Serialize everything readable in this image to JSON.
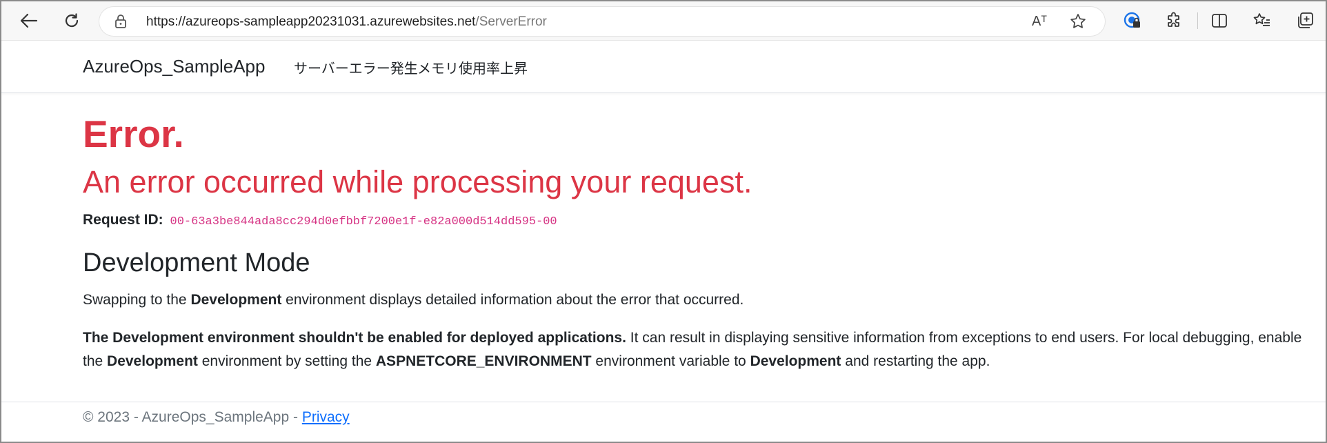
{
  "browser": {
    "url_host": "https://azureops-sampleapp20231031.azurewebsites.net",
    "url_path": "/ServerError",
    "read_aloud_label": "Aᵀ",
    "icons": [
      "back-icon",
      "refresh-icon",
      "lock-icon",
      "read-aloud-icon",
      "favorite-star-icon",
      "account-shield-icon",
      "extensions-icon",
      "split-screen-icon",
      "favorites-icon",
      "collections-icon"
    ]
  },
  "navbar": {
    "brand": "AzureOps_SampleApp",
    "links": [
      "サーバーエラー発生",
      "メモリ使用率上昇"
    ]
  },
  "error": {
    "title": "Error.",
    "subtitle": "An error occurred while processing your request.",
    "request_label": "Request ID:",
    "request_id": "00-63a3be844ada8cc294d0efbbf7200e1f-e82a000d514dd595-00"
  },
  "dev_mode": {
    "heading": "Development Mode",
    "p1_a": "Swapping to the ",
    "p1_b": "Development",
    "p1_c": " environment displays detailed information about the error that occurred.",
    "p2_a": "The Development environment shouldn't be enabled for deployed applications.",
    "p2_b": " It can result in displaying sensitive information from exceptions to end users. For local debugging, enable the ",
    "p2_c": "Development",
    "p2_d": " environment by setting the ",
    "p2_e": "ASPNETCORE_ENVIRONMENT",
    "p2_f": " environment variable to ",
    "p2_g": "Development",
    "p2_h": " and restarting the app."
  },
  "footer": {
    "text": "© 2023 - AzureOps_SampleApp - ",
    "privacy_link": "Privacy"
  },
  "colors": {
    "error_red": "#dc3545",
    "code_pink": "#d63384",
    "link_blue": "#0d6efd",
    "muted_gray": "#6c757d"
  }
}
